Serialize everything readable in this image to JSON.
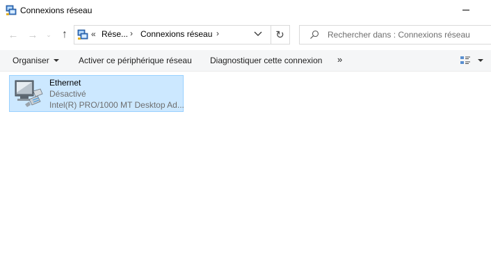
{
  "window": {
    "title": "Connexions réseau"
  },
  "navigation": {
    "breadcrumb_overflow": "«",
    "breadcrumbs": [
      "Rése...",
      "Connexions réseau"
    ],
    "search_placeholder": "Rechercher dans : Connexions réseau"
  },
  "toolbar": {
    "organize_label": "Organiser",
    "activate_label": "Activer ce périphérique réseau",
    "diagnose_label": "Diagnostiquer cette connexion",
    "more_label": "»"
  },
  "connections": [
    {
      "name": "Ethernet",
      "status": "Désactivé",
      "device": "Intel(R) PRO/1000 MT Desktop Ad..."
    }
  ],
  "colors": {
    "selection_fill": "#cce8ff",
    "selection_border": "#99d1ff",
    "command_bar_bg": "#f5f6f7"
  },
  "icons": [
    "network-connections-icon",
    "back-arrow-icon",
    "forward-arrow-icon",
    "recent-locations-icon",
    "up-arrow-icon",
    "refresh-icon",
    "search-icon",
    "view-options-icon",
    "ethernet-adapter-icon"
  ]
}
